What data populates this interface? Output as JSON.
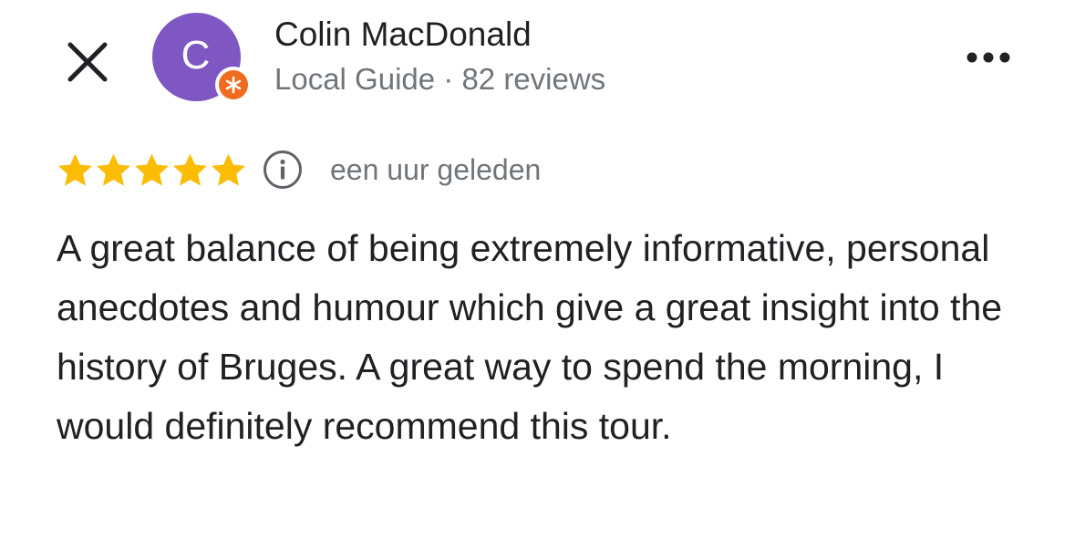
{
  "header": {
    "close_icon": "close-icon",
    "more_icon": "more-horizontal-icon"
  },
  "author": {
    "avatar_letter": "C",
    "avatar_color": "#7e57c2",
    "badge_color": "#f06a1f",
    "badge_icon": "local-guide-star-icon",
    "name": "Colin MacDonald",
    "meta": "Local Guide · 82 reviews"
  },
  "review": {
    "rating": 5,
    "rating_max": 5,
    "star_color": "#fbbc04",
    "info_icon": "info-icon",
    "time": "een uur geleden",
    "text": "A great balance of being extremely informative, personal anecdotes and humour which give a great insight into the history of Bruges. A great way to spend the morning, I would definitely recommend this tour."
  }
}
